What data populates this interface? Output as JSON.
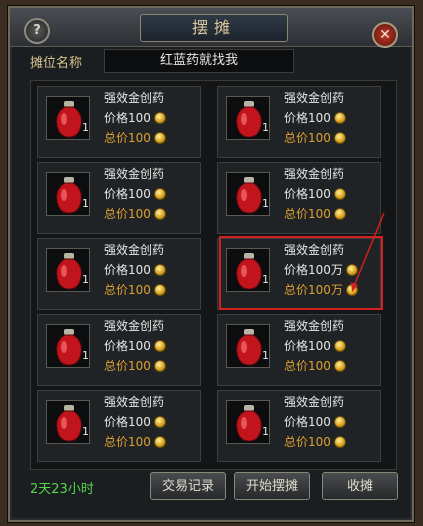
{
  "window": {
    "title": "摆摊",
    "help_label": "?",
    "close_label": "✕"
  },
  "stall": {
    "label": "摊位名称",
    "name": "红蓝药就找我"
  },
  "items": [
    {
      "name": "强效金创药",
      "qty": "1",
      "price": "价格100",
      "total": "总价100"
    },
    {
      "name": "强效金创药",
      "qty": "1",
      "price": "价格100",
      "total": "总价100"
    },
    {
      "name": "强效金创药",
      "qty": "1",
      "price": "价格100",
      "total": "总价100"
    },
    {
      "name": "强效金创药",
      "qty": "1",
      "price": "价格100",
      "total": "总价100"
    },
    {
      "name": "强效金创药",
      "qty": "1",
      "price": "价格100",
      "total": "总价100"
    },
    {
      "name": "强效金创药",
      "qty": "1",
      "price": "价格100万",
      "total": "总价100万"
    },
    {
      "name": "强效金创药",
      "qty": "1",
      "price": "价格100",
      "total": "总价100"
    },
    {
      "name": "强效金创药",
      "qty": "1",
      "price": "价格100",
      "total": "总价100"
    },
    {
      "name": "强效金创药",
      "qty": "1",
      "price": "价格100",
      "total": "总价100"
    },
    {
      "name": "强效金创药",
      "qty": "1",
      "price": "价格100",
      "total": "总价100"
    }
  ],
  "footer": {
    "timer": "2天23小时",
    "trade_log_label": "交易记录",
    "start_stall_label": "开始摆摊",
    "close_stall_label": "收摊"
  },
  "colors": {
    "accent_gold": "#e0a030",
    "timer_green": "#52d64a",
    "highlight_red": "#d02020"
  }
}
